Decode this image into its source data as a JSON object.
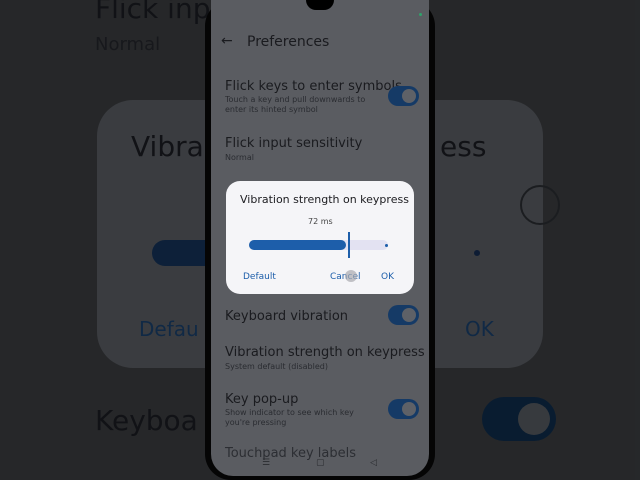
{
  "background": {
    "top_title": "Flick inp",
    "top_sub": "Normal",
    "card_title": "Vibra",
    "card_title_right": "ess",
    "default_label": "Defau",
    "ok_label": "OK",
    "bottom_label": "Keyboa"
  },
  "screen": {
    "header_title": "Preferences",
    "items": [
      {
        "title": "Flick keys to enter symbols",
        "subtitle": "Touch a key and pull downwards to enter its hinted symbol",
        "toggle": true
      },
      {
        "title": "Flick input sensitivity",
        "subtitle": "Normal",
        "toggle": false
      },
      {
        "title": "Keyboard vibration",
        "subtitle": "",
        "toggle": true
      },
      {
        "title": "Vibration strength on keypress",
        "subtitle": "System default (disabled)",
        "toggle": false
      },
      {
        "title": "Key pop-up",
        "subtitle": "Show indicator to see which key you're pressing",
        "toggle": true
      }
    ],
    "cut_item": "Touchpad key labels",
    "nav": {
      "menu": "☰",
      "home": "▢",
      "back": "◁"
    }
  },
  "dialog": {
    "title": "Vibration strength on keypress",
    "value_label": "72 ms",
    "slider_fraction": 0.72,
    "default_button": "Default",
    "cancel_button": "Cancel",
    "ok_button": "OK"
  },
  "colors": {
    "accent": "#1d5eaa",
    "toggle_on": "#153a66"
  }
}
